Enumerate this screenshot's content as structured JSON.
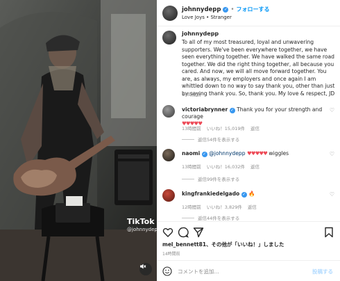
{
  "media": {
    "watermark": "TikTok",
    "watermark_handle": "@johnnydepp",
    "mute_icon": "speaker-muted-icon"
  },
  "header": {
    "username": "johnnydepp",
    "separator": "•",
    "follow_label": "フォローする",
    "subtitle": "Love Joys • Stranger"
  },
  "caption": {
    "username": "johnnydepp",
    "text": "To all of my most treasured, loyal and unwavering supporters. We've been everywhere together, we have seen everything together. We have walked the same road together. We did the right thing together, all because you cared. And now, we will all move forward together. You are, as always, my employers and once again I am whittled down to no way to say thank you, other than just by saying thank you. So, thank you. My love & respect, JD",
    "time": "14時間前"
  },
  "comments": [
    {
      "username": "victoriabrynner",
      "text": "Thank you for your strength and courage",
      "emoji": "♥♥♥♥♥",
      "time": "13時間前",
      "likes": "いいね！15,019件",
      "reply_label": "返信",
      "view_replies": "返信54件を表示する"
    },
    {
      "username": "naomi",
      "mention": "@johnnydepp",
      "emoji": "♥♥♥♥♥",
      "text": "wiggles",
      "time": "13時間前",
      "likes": "いいね！16,032件",
      "reply_label": "返信",
      "view_replies": "返信99件を表示する"
    },
    {
      "username": "kingfrankiedelgado",
      "emoji": "🔥",
      "time": "12時間前",
      "likes": "いいね！3,829件",
      "reply_label": "返信",
      "view_replies": "返信44件を表示する"
    }
  ],
  "actions": {
    "liked_by_user": "mel_bennett81",
    "liked_by_rest": "、その他が「いいね！」しました",
    "post_time": "14時間前"
  },
  "comment_box": {
    "placeholder": "コメントを追加...",
    "post_label": "投稿する"
  },
  "colors": {
    "accent": "#0095f6",
    "verified": "#3797f0",
    "heart": "#ed4956"
  }
}
